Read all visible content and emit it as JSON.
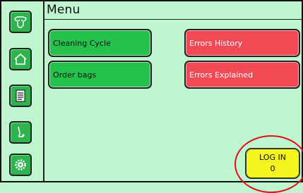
{
  "header": {
    "title": "Menu"
  },
  "sidebar": {
    "items": [
      {
        "icon": "cow-head-icon"
      },
      {
        "icon": "home-icon"
      },
      {
        "icon": "document-list-icon"
      },
      {
        "icon": "leg-sensor-icon"
      },
      {
        "icon": "gear-settings-icon"
      }
    ]
  },
  "menu": {
    "cleaning_cycle": "Cleaning Cycle",
    "order_bags": "Order bags",
    "errors_history": "Errors History",
    "errors_explained": "Errors Explained"
  },
  "login": {
    "label": "LOG IN",
    "value": "0"
  },
  "colors": {
    "background": "#bff5cf",
    "green_button": "#24c14d",
    "red_button": "#f24a55",
    "login_button": "#f4f41f",
    "highlight": "#e0101a"
  }
}
